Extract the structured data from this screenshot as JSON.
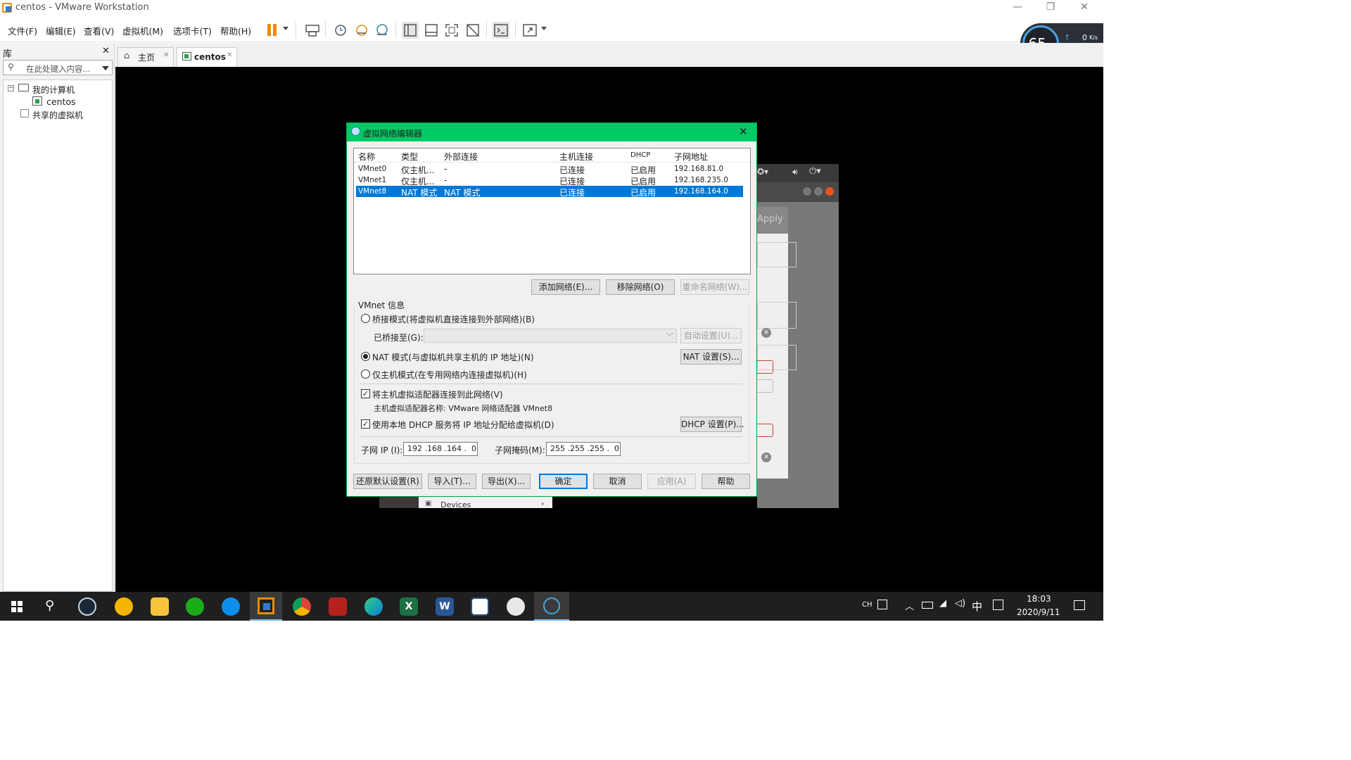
{
  "window": {
    "title": "centos - VMware Workstation"
  },
  "menu": [
    "文件(F)",
    "编辑(E)",
    "查看(V)",
    "虚拟机(M)",
    "选项卡(T)",
    "帮助(H)"
  ],
  "netspeed": {
    "percent": "65",
    "unit": "%",
    "up": "0",
    "down": "0",
    "rate_unit": "K/s"
  },
  "library": {
    "title": "库",
    "search_placeholder": "在此处键入内容...",
    "my_computer": "我的计算机",
    "vm": "centos",
    "shared": "共享的虚拟机"
  },
  "tabs": {
    "home": "主页",
    "vm": "centos"
  },
  "bg": {
    "apply": "Apply",
    "devices": "Devices"
  },
  "dialog": {
    "title": "虚拟网络编辑器",
    "headers": [
      "名称",
      "类型",
      "外部连接",
      "主机连接",
      "DHCP",
      "子网地址"
    ],
    "rows": [
      [
        "VMnet0",
        "仅主机...",
        "-",
        "已连接",
        "已启用",
        "192.168.81.0"
      ],
      [
        "VMnet1",
        "仅主机...",
        "-",
        "已连接",
        "已启用",
        "192.168.235.0"
      ],
      [
        "VMnet8",
        "NAT 模式",
        "NAT 模式",
        "已连接",
        "已启用",
        "192.168.164.0"
      ]
    ],
    "selected_row": 2,
    "add_network": "添加网络(E)...",
    "remove_network": "移除网络(O)",
    "rename_network": "重命名网络(W)...",
    "vmnet_info": "VMnet 信息",
    "bridge_mode": "桥接模式(将虚拟机直接连接到外部网络)(B)",
    "bridged_to": "已桥接至(G):",
    "auto_settings": "自动设置(U)...",
    "nat_mode": "NAT 模式(与虚拟机共享主机的 IP 地址)(N)",
    "nat_settings": "NAT 设置(S)...",
    "host_only": "仅主机模式(在专用网络内连接虚拟机)(H)",
    "connect_adapter": "将主机虚拟适配器连接到此网络(V)",
    "adapter_name": "主机虚拟适配器名称: VMware 网络适配器 VMnet8",
    "use_dhcp": "使用本地 DHCP 服务将 IP 地址分配给虚拟机(D)",
    "dhcp_settings": "DHCP 设置(P)...",
    "subnet_ip_label": "子网 IP (I):",
    "subnet_ip": "192 .168 .164 .  0",
    "subnet_mask_label": "子网掩码(M):",
    "subnet_mask": "255 .255 .255 .  0",
    "restore_defaults": "还原默认设置(R)",
    "import": "导入(T)...",
    "export": "导出(X)...",
    "ok": "确定",
    "cancel": "取消",
    "apply": "应用(A)",
    "help": "帮助"
  },
  "taskbar": {
    "lang1": "CH",
    "lang2": "中",
    "time": "18:03",
    "date": "2020/9/11"
  }
}
